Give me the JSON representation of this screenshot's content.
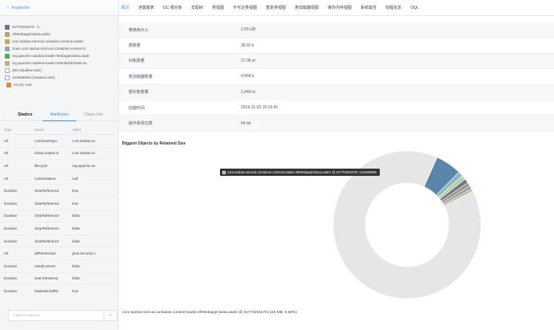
{
  "inspector": {
    "title": "Inspector",
    "objects": [
      {
        "icon": "address-icon",
        "text": "0x770204e78"
      },
      {
        "icon": "class-icon",
        "text": "AllWebappClassLoader"
      },
      {
        "icon": "gear-icon",
        "text": "com.taobao.tomcat.container.context.loader"
      },
      {
        "icon": "class-file-icon",
        "text": "class com.taobao.tomcat.container.context.lo"
      },
      {
        "icon": "green-class-icon",
        "text": "org.apache.catalina.loader.WebappClassLoade"
      },
      {
        "icon": "package-icon",
        "text": "org.apache.catalina.loader.StandardClassLoa"
      },
      {
        "icon": "number-icon",
        "text": "200 (shallow size)"
      },
      {
        "icon": "number-icon",
        "text": "124936936 (retained size)"
      },
      {
        "icon": "gc-root-icon",
        "text": "no GC root"
      }
    ],
    "tabs": [
      "Statics",
      "Attributes",
      "Class Hie"
    ],
    "table": {
      "headers": [
        "Type",
        "Name",
        "Value"
      ],
      "rows": [
        [
          "ref",
          "commonRepo",
          "com.taobao.to"
        ],
        [
          "ref",
          "classLoaderLis",
          "com.taobao.to"
        ],
        [
          "ref",
          "lifecycle",
          "org.apache.ca"
        ],
        [
          "ref",
          "contextName",
          "null"
        ],
        [
          "boolean",
          "clearReference",
          "true"
        ],
        [
          "boolean",
          "clearReference",
          "true"
        ],
        [
          "boolean",
          "clearReference",
          "false"
        ],
        [
          "boolean",
          "clearReference",
          "false"
        ],
        [
          "boolean",
          "clearReference",
          "false"
        ],
        [
          "ref",
          "allPermission",
          "java.security.A"
        ],
        [
          "boolean",
          "needConvert",
          "false"
        ],
        [
          "boolean",
          "searchExterna",
          "false"
        ],
        [
          "boolean",
          "hasExternalRe",
          "true"
        ]
      ]
    },
    "search_placeholder": "Object Address"
  },
  "nav": [
    "概况",
    "泄露报表",
    "GC 根对象",
    "支配树",
    "类视图",
    "不可达类视图",
    "重复类视图",
    "类加载器视图",
    "堆外内存视图",
    "系统属性",
    "线程信息",
    "OQL"
  ],
  "summary": [
    {
      "label": "堆使用大小",
      "value": "2.05 GB"
    },
    {
      "label": "类数量",
      "value": "39.92 k"
    },
    {
      "label": "对象数量",
      "value": "27.06 m"
    },
    {
      "label": "类加载器数量",
      "value": "4,868 k"
    },
    {
      "label": "根对象数量",
      "value": "2,449 m"
    },
    {
      "label": "创建时间",
      "value": "2019-11-03 10:16:42"
    },
    {
      "label": "操作系统位数",
      "value": "64 bit"
    }
  ],
  "chart_data": {
    "type": "pie",
    "title": "Biggest Objects by Retained Size",
    "slices": [
      {
        "label": "com.taobao.tomcat.container.context.loader.AllWebappClassLoader @ 0x770204e78",
        "percent": 5.68,
        "color": "#5b85a8"
      },
      {
        "percent": 1.1,
        "color": "#8fb3c9"
      },
      {
        "percent": 0.9,
        "color": "#b9cfa0"
      },
      {
        "percent": 1.0,
        "color": "#6f7a8a"
      },
      {
        "percent": 0.8,
        "color": "#a88f7a"
      },
      {
        "percent": 0.7,
        "color": "#8d9fb3"
      },
      {
        "percent": 0.6,
        "color": "#c4b48a"
      },
      {
        "percent": 89.22,
        "color": "#e6e6e6"
      }
    ],
    "tooltip": "com.taobao.tomcat.container.context.loader.AllWebappClassLoader @ 0x770204e78: 124936936"
  },
  "status_text": "com.taobao.tomcat.container.context.loader.AllWebappClassLoader @ 0x770204e78 (119 MB, 5.68%)"
}
